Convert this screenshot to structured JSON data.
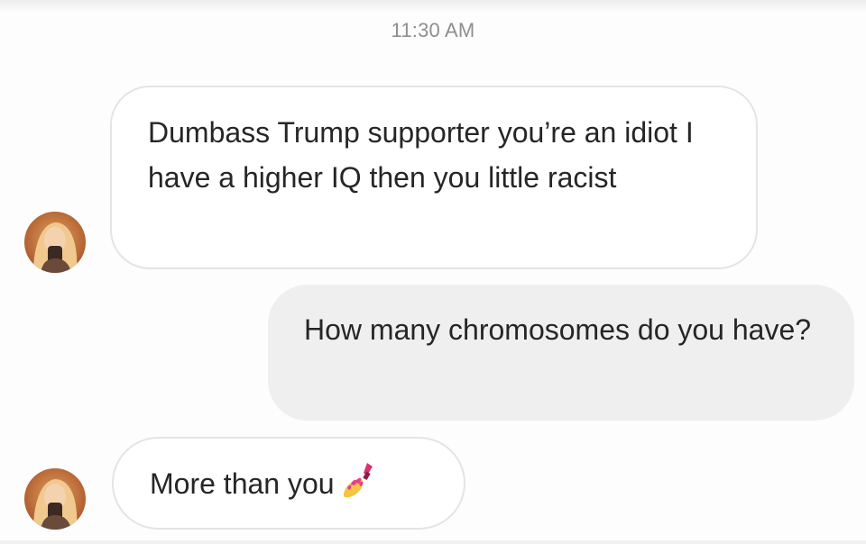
{
  "thread": {
    "timestamp": "11:30 AM"
  },
  "messages": [
    {
      "sender": "other",
      "text": "Dumbass Trump supporter you’re an idiot I have a higher IQ then you little racist"
    },
    {
      "sender": "self",
      "text": "How many chromosomes do you have?"
    },
    {
      "sender": "other",
      "text": "More than you",
      "emoji": "nail-polish-icon"
    }
  ],
  "colors": {
    "received_bubble_bg": "#ffffff",
    "received_bubble_border": "#e4e4e4",
    "sent_bubble_bg": "#efefef",
    "text": "#262626",
    "timestamp": "#8e8e8e"
  }
}
